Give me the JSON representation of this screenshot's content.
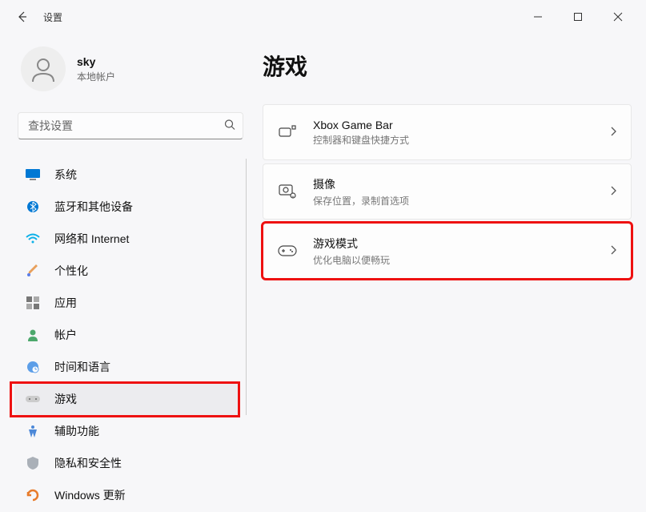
{
  "window": {
    "title": "设置"
  },
  "profile": {
    "name": "sky",
    "sub": "本地帐户"
  },
  "search": {
    "placeholder": "查找设置"
  },
  "sidebar": {
    "items": [
      {
        "label": "系统"
      },
      {
        "label": "蓝牙和其他设备"
      },
      {
        "label": "网络和 Internet"
      },
      {
        "label": "个性化"
      },
      {
        "label": "应用"
      },
      {
        "label": "帐户"
      },
      {
        "label": "时间和语言"
      },
      {
        "label": "游戏"
      },
      {
        "label": "辅助功能"
      },
      {
        "label": "隐私和安全性"
      },
      {
        "label": "Windows 更新"
      }
    ]
  },
  "page": {
    "title": "游戏"
  },
  "cards": [
    {
      "title": "Xbox Game Bar",
      "sub": "控制器和键盘快捷方式"
    },
    {
      "title": "摄像",
      "sub": "保存位置，录制首选项"
    },
    {
      "title": "游戏模式",
      "sub": "优化电脑以便畅玩"
    }
  ]
}
